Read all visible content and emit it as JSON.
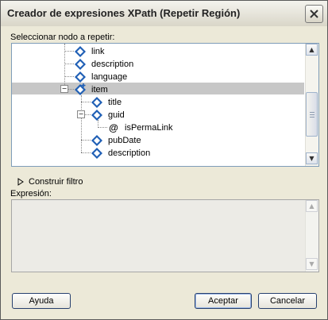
{
  "window": {
    "title": "Creador de expresiones XPath (Repetir Región)"
  },
  "labels": {
    "select_node": "Seleccionar nodo a repetir:",
    "filter": "Construir filtro",
    "expression": "Expresión:"
  },
  "tree": {
    "nodes": [
      {
        "label": "link",
        "type": "element"
      },
      {
        "label": "description",
        "type": "element"
      },
      {
        "label": "language",
        "type": "element"
      },
      {
        "label": "item",
        "type": "element-repeating",
        "selected": true,
        "expanded": true
      },
      {
        "label": "title",
        "type": "element"
      },
      {
        "label": "guid",
        "type": "element",
        "expanded": true
      },
      {
        "label": "isPermaLink",
        "type": "attribute",
        "icon_glyph": "@"
      },
      {
        "label": "pubDate",
        "type": "element"
      },
      {
        "label": "description",
        "type": "element"
      }
    ]
  },
  "expression": {
    "value": ""
  },
  "buttons": {
    "help": "Ayuda",
    "ok": "Aceptar",
    "cancel": "Cancelar"
  },
  "colors": {
    "selection": "#c7c7c7",
    "icon_blue": "#1f5fb5",
    "dialog_bg": "#ece9d8"
  }
}
